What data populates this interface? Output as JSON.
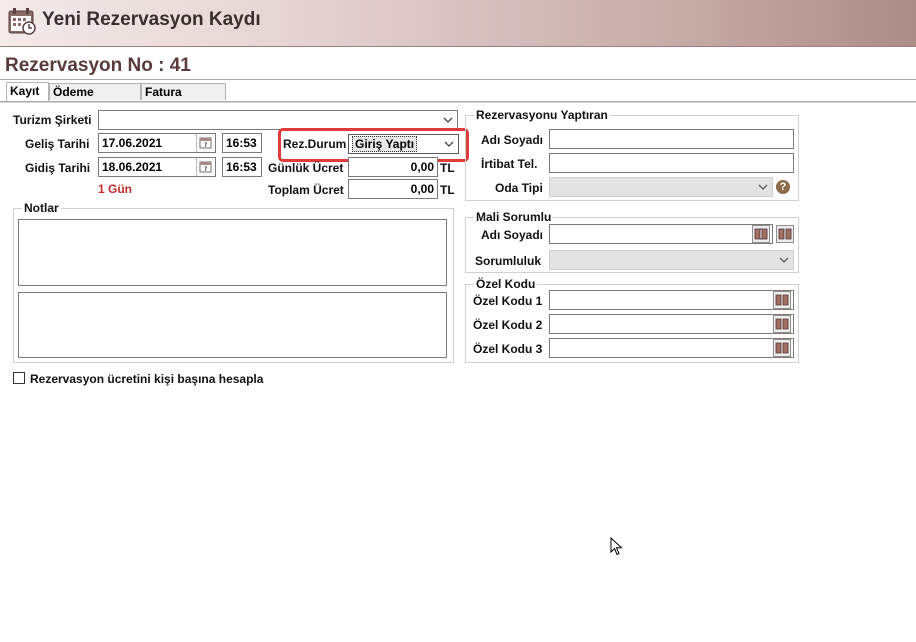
{
  "window": {
    "title": "Yeni Rezervasyon Kaydı"
  },
  "reservation": {
    "heading": "Rezervasyon No : 41"
  },
  "tabs": [
    {
      "label": "Kayıt"
    },
    {
      "label": "Ödeme Bilgileri"
    },
    {
      "label": "Fatura Basımı"
    }
  ],
  "form": {
    "turizm_label": "Turizm Şirketi",
    "turizm_value": "",
    "gelis_label": "Geliş Tarihi",
    "gelis_date": "17.06.2021",
    "gelis_time": "16:53",
    "gidis_label": "Gidiş Tarihi",
    "gidis_date": "18.06.2021",
    "gidis_time": "16:53",
    "duration": "1 Gün",
    "rez_durum_label": "Rez.Durum",
    "rez_durum_value": "Giriş Yaptı",
    "gunluk_label": "Günlük Ücret",
    "gunluk_value": "0,00",
    "toplam_label": "Toplam Ücret",
    "toplam_value": "0,00",
    "currency": "TL",
    "notlar_label": "Notlar",
    "checkbox_label": "Rezervasyon ücretini kişi başına hesapla"
  },
  "yaptiran": {
    "title": "Rezervasyonu Yaptıran",
    "adi_label": "Adı Soyadı",
    "adi_value": "",
    "irtibat_label": "İrtibat Tel.",
    "irtibat_value": "",
    "oda_label": "Oda Tipi",
    "oda_value": ""
  },
  "mali": {
    "title": "Mali Sorumlu",
    "adi_label": "Adı Soyadı",
    "adi_value": "",
    "sorumluluk_label": "Sorumluluk",
    "sorumluluk_value": ""
  },
  "ozel": {
    "title": "Özel Kodu",
    "kod1_label": "Özel Kodu 1",
    "kod2_label": "Özel Kodu 2",
    "kod3_label": "Özel Kodu 3",
    "kod1_value": "",
    "kod2_value": "",
    "kod3_value": ""
  },
  "colors": {
    "title_bar": "#c6aaa6",
    "heading": "#5a3a3a",
    "highlight": "#e03a3a",
    "duration_text": "#c42d2d"
  }
}
